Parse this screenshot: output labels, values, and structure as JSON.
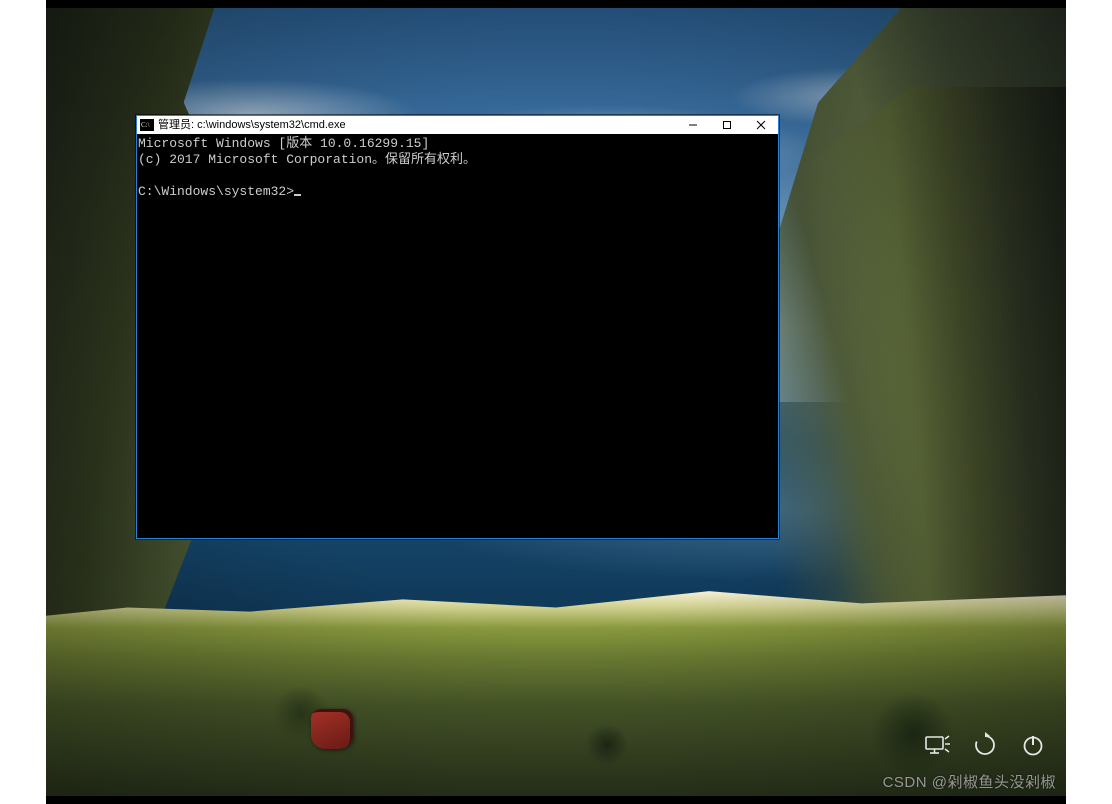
{
  "cmd": {
    "title": "管理员: c:\\windows\\system32\\cmd.exe",
    "line1": "Microsoft Windows [版本 10.0.16299.15]",
    "line2": "(c) 2017 Microsoft Corporation。保留所有权利。",
    "prompt": "C:\\Windows\\system32>"
  },
  "watermark": "CSDN @剁椒鱼头没剁椒"
}
